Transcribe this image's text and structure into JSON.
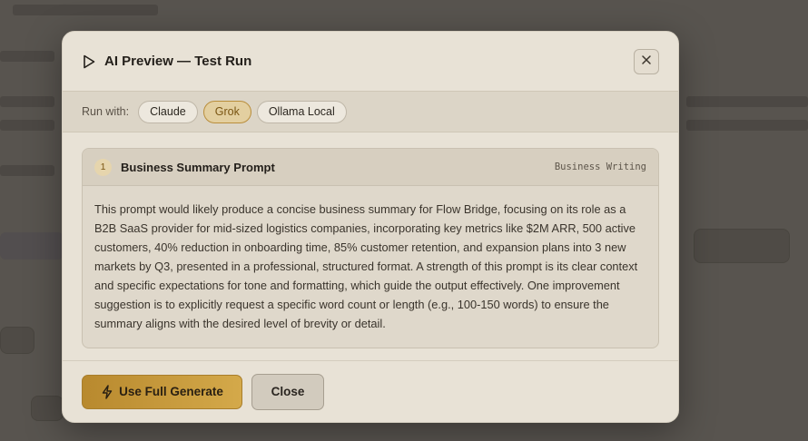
{
  "modal": {
    "title": "AI Preview — Test Run",
    "close_icon": "close-icon",
    "run_with": {
      "label": "Run with:",
      "options": [
        "Claude",
        "Grok",
        "Ollama Local"
      ],
      "selected": "Grok"
    },
    "results": [
      {
        "index": "1",
        "title": "Business Summary Prompt",
        "category": "Business Writing",
        "body": "This prompt would likely produce a concise business summary for Flow Bridge, focusing on its role as a B2B SaaS provider for mid-sized logistics companies, incorporating key metrics like $2M ARR, 500 active customers, 40% reduction in onboarding time, 85% customer retention, and expansion plans into 3 new markets by Q3, presented in a professional, structured format. A strength of this prompt is its clear context and specific expectations for tone and formatting, which guide the output effectively. One improvement suggestion is to explicitly request a specific word count or length (e.g., 100-150 words) to ensure the summary aligns with the desired level of brevity or detail."
      }
    ],
    "footer": {
      "primary_label": "Use Full Generate",
      "secondary_label": "Close"
    }
  },
  "colors": {
    "accent": "#c99a3c",
    "modal_bg": "#e8e2d6",
    "backdrop": "#65615b"
  }
}
